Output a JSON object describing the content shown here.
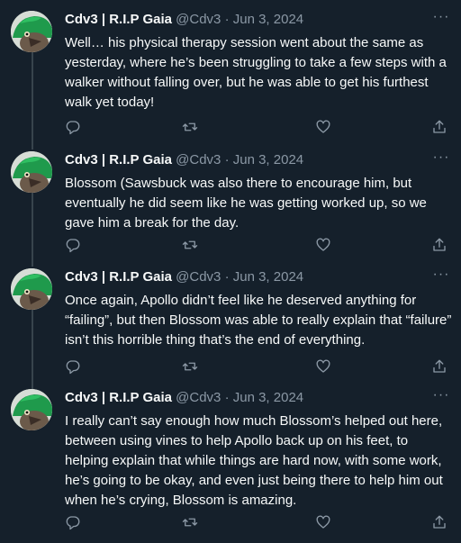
{
  "tweets": [
    {
      "author_name": "Cdv3 | R.I.P Gaia",
      "handle": "@Cdv3",
      "separator": "·",
      "date": "Jun 3, 2024",
      "text": "Well… his physical therapy session went about the same as yesterday, where he’s been struggling to take a few steps with a walker without falling over, but he was able to get his furthest walk yet today!"
    },
    {
      "author_name": "Cdv3 | R.I.P Gaia",
      "handle": "@Cdv3",
      "separator": "·",
      "date": "Jun 3, 2024",
      "text": "Blossom (Sawsbuck was also there to encourage him, but eventually he did seem like he was getting worked up, so we gave him a break for the day."
    },
    {
      "author_name": "Cdv3 | R.I.P Gaia",
      "handle": "@Cdv3",
      "separator": "·",
      "date": "Jun 3, 2024",
      "text": "Once again, Apollo didn’t feel like he deserved anything for “failing”, but then Blossom was able to really explain that “failure” isn’t this horrible thing that’s the end of everything."
    },
    {
      "author_name": "Cdv3 | R.I.P Gaia",
      "handle": "@Cdv3",
      "separator": "·",
      "date": "Jun 3, 2024",
      "text": "I really can’t say enough how much Blossom’s helped out here, between using vines to help Apollo back up on his feet, to helping explain that while things are hard now, with some work, he’s going to be okay, and even just being there to help him out when he’s crying, Blossom is amazing."
    }
  ],
  "more_glyph": "···",
  "icons": [
    "reply-icon",
    "retweet-icon",
    "like-icon",
    "share-icon",
    "more-icon"
  ],
  "colors": {
    "background": "#15202b",
    "text": "#f7f9f9",
    "muted": "#8b98a5",
    "thread_line": "#38444d",
    "avatar_green": "#1f9a4c"
  }
}
